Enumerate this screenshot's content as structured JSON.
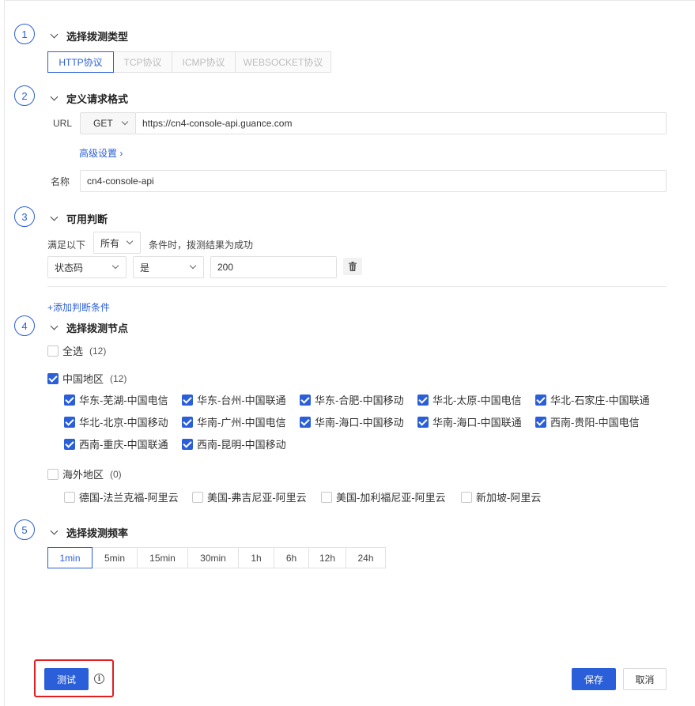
{
  "steps": [
    {
      "num": "1",
      "title": "选择拨测类型"
    },
    {
      "num": "2",
      "title": "定义请求格式"
    },
    {
      "num": "3",
      "title": "可用判断"
    },
    {
      "num": "4",
      "title": "选择拨测节点"
    },
    {
      "num": "5",
      "title": "选择拨测频率"
    }
  ],
  "protocols": [
    "HTTP协议",
    "TCP协议",
    "ICMP协议",
    "WEBSOCKET协议"
  ],
  "request": {
    "url_label": "URL",
    "method": "GET",
    "url_value": "https://cn4-console-api.guance.com",
    "advanced_link": "高级设置 ›",
    "name_label": "名称",
    "name_value": "cn4-console-api"
  },
  "judge": {
    "prefix": "满足以下",
    "mode": "所有",
    "suffix": "条件时，拨测结果为成功",
    "field": "状态码",
    "operator": "是",
    "value": "200",
    "add_link": "+添加判断条件"
  },
  "nodes": {
    "select_all": {
      "label": "全选",
      "count": "(12)",
      "checked": false
    },
    "china": {
      "label": "中国地区",
      "count": "(12)",
      "checked": true
    },
    "china_items": [
      "华东-芜湖-中国电信",
      "华东-台州-中国联通",
      "华东-合肥-中国移动",
      "华北-太原-中国电信",
      "华北-石家庄-中国联通",
      "华北-北京-中国移动",
      "华南-广州-中国电信",
      "华南-海口-中国移动",
      "华南-海口-中国联通",
      "西南-贵阳-中国电信",
      "西南-重庆-中国联通",
      "西南-昆明-中国移动"
    ],
    "overseas": {
      "label": "海外地区",
      "count": "(0)",
      "checked": false
    },
    "overseas_items": [
      "德国-法兰克福-阿里云",
      "美国-弗吉尼亚-阿里云",
      "美国-加利福尼亚-阿里云",
      "新加坡-阿里云"
    ]
  },
  "frequencies": [
    "1min",
    "5min",
    "15min",
    "30min",
    "1h",
    "6h",
    "12h",
    "24h"
  ],
  "footer": {
    "test_label": "测试",
    "save_label": "保存",
    "cancel_label": "取消"
  },
  "colors": {
    "accent": "#2b5fd9",
    "highlight": "#e02020"
  }
}
